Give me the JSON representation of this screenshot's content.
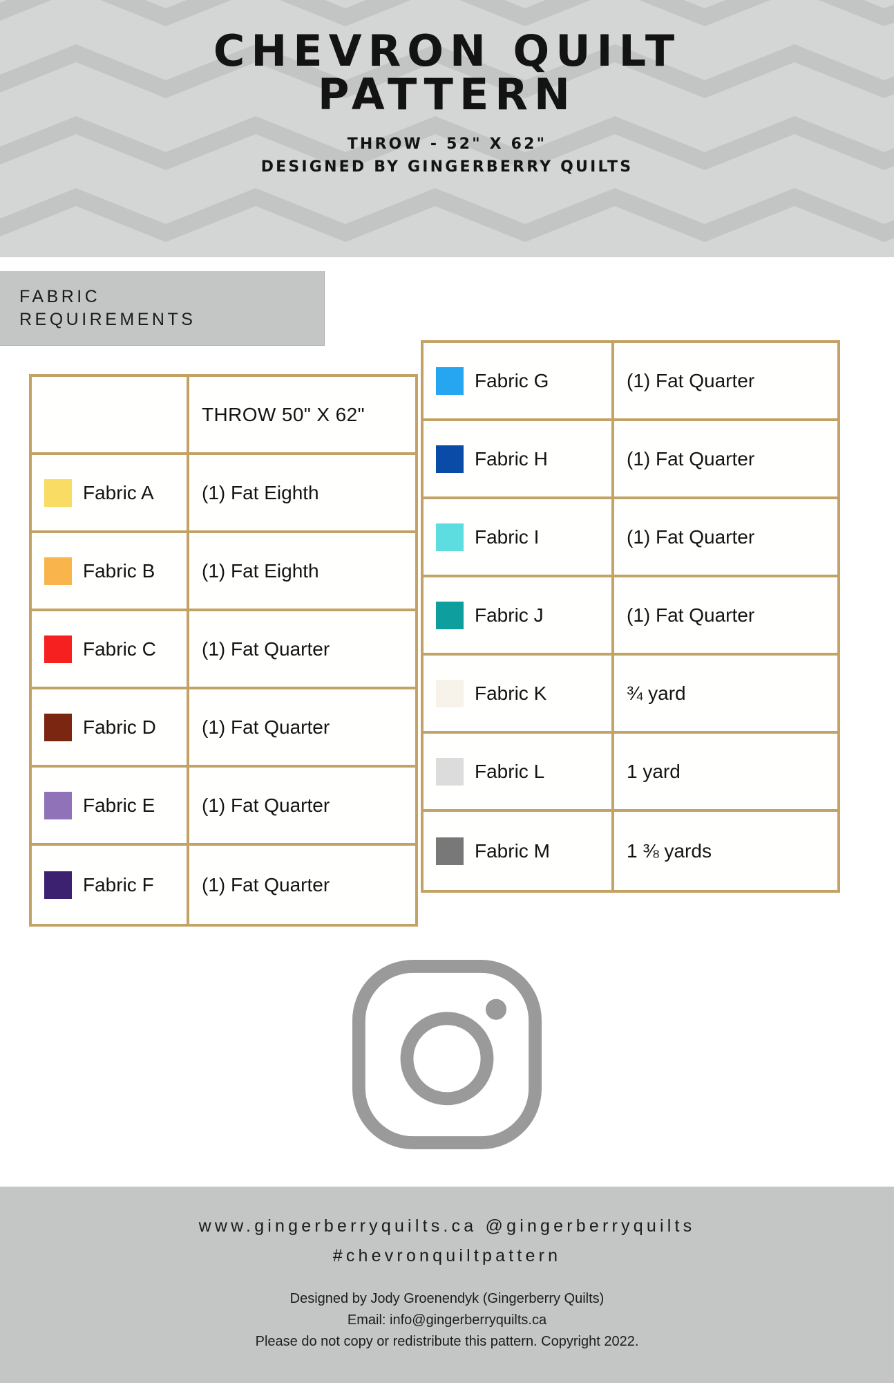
{
  "header": {
    "title_line1": "CHEVRON QUILT",
    "title_line2": "PATTERN",
    "subtitle_line1": "THROW - 52\" X 62\"",
    "subtitle_line2": "DESIGNED BY GINGERBERRY QUILTS",
    "pattern_bg_light": "#d4d6d6",
    "pattern_bg_dark": "#c3c5c5"
  },
  "section": {
    "label_line1": "FABRIC",
    "label_line2": "REQUIREMENTS",
    "bg": "#c4c6c6"
  },
  "table": {
    "border_color": "#c2a265",
    "left": {
      "header_blank": "",
      "header_size": "THROW 50\" X 62\"",
      "rows": [
        {
          "swatch": "#f8dc63",
          "name": "Fabric A",
          "amount": "(1) Fat Eighth"
        },
        {
          "swatch": "#f9b44c",
          "name": "Fabric B",
          "amount": "(1) Fat Eighth"
        },
        {
          "swatch": "#f72020",
          "name": "Fabric C",
          "amount": "(1) Fat Quarter"
        },
        {
          "swatch": "#7a2610",
          "name": "Fabric D",
          "amount": "(1) Fat Quarter"
        },
        {
          "swatch": "#8f72b8",
          "name": "Fabric E",
          "amount": "(1) Fat Quarter"
        },
        {
          "swatch": "#3b2170",
          "name": "Fabric F",
          "amount": "(1) Fat Quarter"
        }
      ]
    },
    "right": {
      "rows": [
        {
          "swatch": "#26a5f0",
          "name": "Fabric G",
          "amount": "(1) Fat Quarter"
        },
        {
          "swatch": "#0b4ba8",
          "name": "Fabric H",
          "amount": "(1) Fat Quarter"
        },
        {
          "swatch": "#5ddde0",
          "name": "Fabric I",
          "amount": "(1) Fat Quarter"
        },
        {
          "swatch": "#0e9e9e",
          "name": "Fabric J",
          "amount": "(1) Fat Quarter"
        },
        {
          "swatch": "#f7f3eb",
          "name": "Fabric K",
          "amount": "¾ yard"
        },
        {
          "swatch": "#dcdcdc",
          "name": "Fabric L",
          "amount": "1 yard"
        },
        {
          "swatch": "#787878",
          "name": "Fabric M",
          "amount": "1 ⅜ yards"
        }
      ]
    }
  },
  "social": {
    "icon_name": "instagram-icon",
    "icon_color": "#9a9a9a"
  },
  "footer": {
    "handle_line1": "www.gingerberryquilts.ca @gingerberryquilts",
    "handle_line2": "#chevronquiltpattern",
    "fine_line1": "Designed by Jody Groenendyk (Gingerberry Quilts)",
    "fine_line2": "Email: info@gingerberryquilts.ca",
    "fine_line3": "Please do not copy or redistribute this pattern. Copyright 2022."
  }
}
